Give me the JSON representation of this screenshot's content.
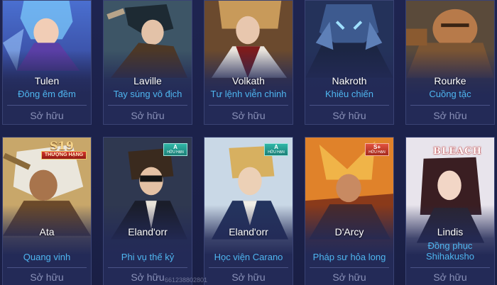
{
  "cards": [
    {
      "hero": "Tulen",
      "skin": "Đông êm đềm",
      "status": "Sở hữu"
    },
    {
      "hero": "Laville",
      "skin": "Tay súng vô địch",
      "status": "Sở hữu"
    },
    {
      "hero": "Volkath",
      "skin": "Tư lệnh viễn chinh",
      "status": "Sở hữu"
    },
    {
      "hero": "Nakroth",
      "skin": "Khiêu chiến",
      "status": "Sở hữu"
    },
    {
      "hero": "Rourke",
      "skin": "Cuồng tặc",
      "status": "Sở hữu"
    },
    {
      "hero": "Ata",
      "skin": "Quang vinh",
      "status": "Sở hữu",
      "badge": {
        "season": "S19",
        "label": "THƯỢNG HẠNG"
      }
    },
    {
      "hero": "Eland'orr",
      "skin": "Phi vụ thế kỷ",
      "status": "Sở hữu",
      "tag": {
        "grade": "A",
        "label": "HỮU HẠN"
      }
    },
    {
      "hero": "Eland'orr",
      "skin": "Học viện Carano",
      "status": "Sở hữu",
      "tag": {
        "grade": "A",
        "label": "HỮU HẠN"
      }
    },
    {
      "hero": "D'Arcy",
      "skin": "Pháp sư hỏa long",
      "status": "Sở hữu",
      "tag": {
        "grade": "S+",
        "label": "HỮU HẠN"
      }
    },
    {
      "hero": "Lindis",
      "skin": "Đồng phục Shihakusho",
      "status": "Sở hữu",
      "logo": "BLEACH"
    }
  ],
  "watermark": "661238802801",
  "colors": {
    "background": "#1b2148",
    "card": "#232a57",
    "skin_name": "#4fb6f0",
    "owned": "#8a91b8"
  }
}
